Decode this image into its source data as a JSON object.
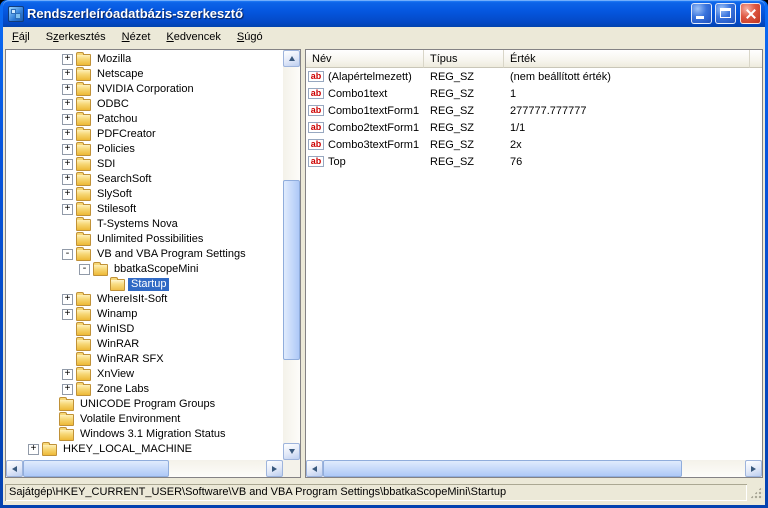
{
  "window": {
    "title": "Rendszerleíróadatbázis-szerkesztő"
  },
  "menu": {
    "items": [
      {
        "label": "Fájl",
        "underline": 0
      },
      {
        "label": "Szerkesztés",
        "underline": 1
      },
      {
        "label": "Nézet",
        "underline": 0
      },
      {
        "label": "Kedvencek",
        "underline": 0
      },
      {
        "label": "Súgó",
        "underline": 0
      }
    ]
  },
  "tree": {
    "items": [
      {
        "label": "Mozilla",
        "level": 3,
        "expand": "plus"
      },
      {
        "label": "Netscape",
        "level": 3,
        "expand": "plus"
      },
      {
        "label": "NVIDIA Corporation",
        "level": 3,
        "expand": "plus"
      },
      {
        "label": "ODBC",
        "level": 3,
        "expand": "plus"
      },
      {
        "label": "Patchou",
        "level": 3,
        "expand": "plus"
      },
      {
        "label": "PDFCreator",
        "level": 3,
        "expand": "plus"
      },
      {
        "label": "Policies",
        "level": 3,
        "expand": "plus"
      },
      {
        "label": "SDI",
        "level": 3,
        "expand": "plus"
      },
      {
        "label": "SearchSoft",
        "level": 3,
        "expand": "plus"
      },
      {
        "label": "SlySoft",
        "level": 3,
        "expand": "plus"
      },
      {
        "label": "Stilesoft",
        "level": 3,
        "expand": "plus"
      },
      {
        "label": "T-Systems Nova",
        "level": 3,
        "expand": "none"
      },
      {
        "label": "Unlimited Possibilities",
        "level": 3,
        "expand": "none"
      },
      {
        "label": "VB and VBA Program Settings",
        "level": 3,
        "expand": "minus"
      },
      {
        "label": "bbatkaScopeMini",
        "level": 4,
        "expand": "minus"
      },
      {
        "label": "Startup",
        "level": 5,
        "expand": "none",
        "selected": true
      },
      {
        "label": "WhereIsIt-Soft",
        "level": 3,
        "expand": "plus"
      },
      {
        "label": "Winamp",
        "level": 3,
        "expand": "plus"
      },
      {
        "label": "WinISD",
        "level": 3,
        "expand": "none"
      },
      {
        "label": "WinRAR",
        "level": 3,
        "expand": "none"
      },
      {
        "label": "WinRAR SFX",
        "level": 3,
        "expand": "none"
      },
      {
        "label": "XnView",
        "level": 3,
        "expand": "plus"
      },
      {
        "label": "Zone Labs",
        "level": 3,
        "expand": "plus"
      },
      {
        "label": "UNICODE Program Groups",
        "level": 2,
        "expand": "none"
      },
      {
        "label": "Volatile Environment",
        "level": 2,
        "expand": "none"
      },
      {
        "label": "Windows 3.1 Migration Status",
        "level": 2,
        "expand": "none"
      },
      {
        "label": "HKEY_LOCAL_MACHINE",
        "level": 1,
        "expand": "plus"
      }
    ]
  },
  "list": {
    "columns": [
      "Név",
      "Típus",
      "Érték"
    ],
    "rows": [
      {
        "name": "(Alapértelmezett)",
        "type": "REG_SZ",
        "value": "(nem beállított érték)"
      },
      {
        "name": "Combo1text",
        "type": "REG_SZ",
        "value": "1"
      },
      {
        "name": "Combo1textForm1",
        "type": "REG_SZ",
        "value": "277777.777777"
      },
      {
        "name": "Combo2textForm1",
        "type": "REG_SZ",
        "value": "1/1"
      },
      {
        "name": "Combo3textForm1",
        "type": "REG_SZ",
        "value": "2x"
      },
      {
        "name": "Top",
        "type": "REG_SZ",
        "value": "76"
      }
    ]
  },
  "icons": {
    "string_value_glyph": "ab"
  },
  "statusbar": {
    "text": "Sajátgép\\HKEY_CURRENT_USER\\Software\\VB and VBA Program Settings\\bbatkaScopeMini\\Startup"
  }
}
